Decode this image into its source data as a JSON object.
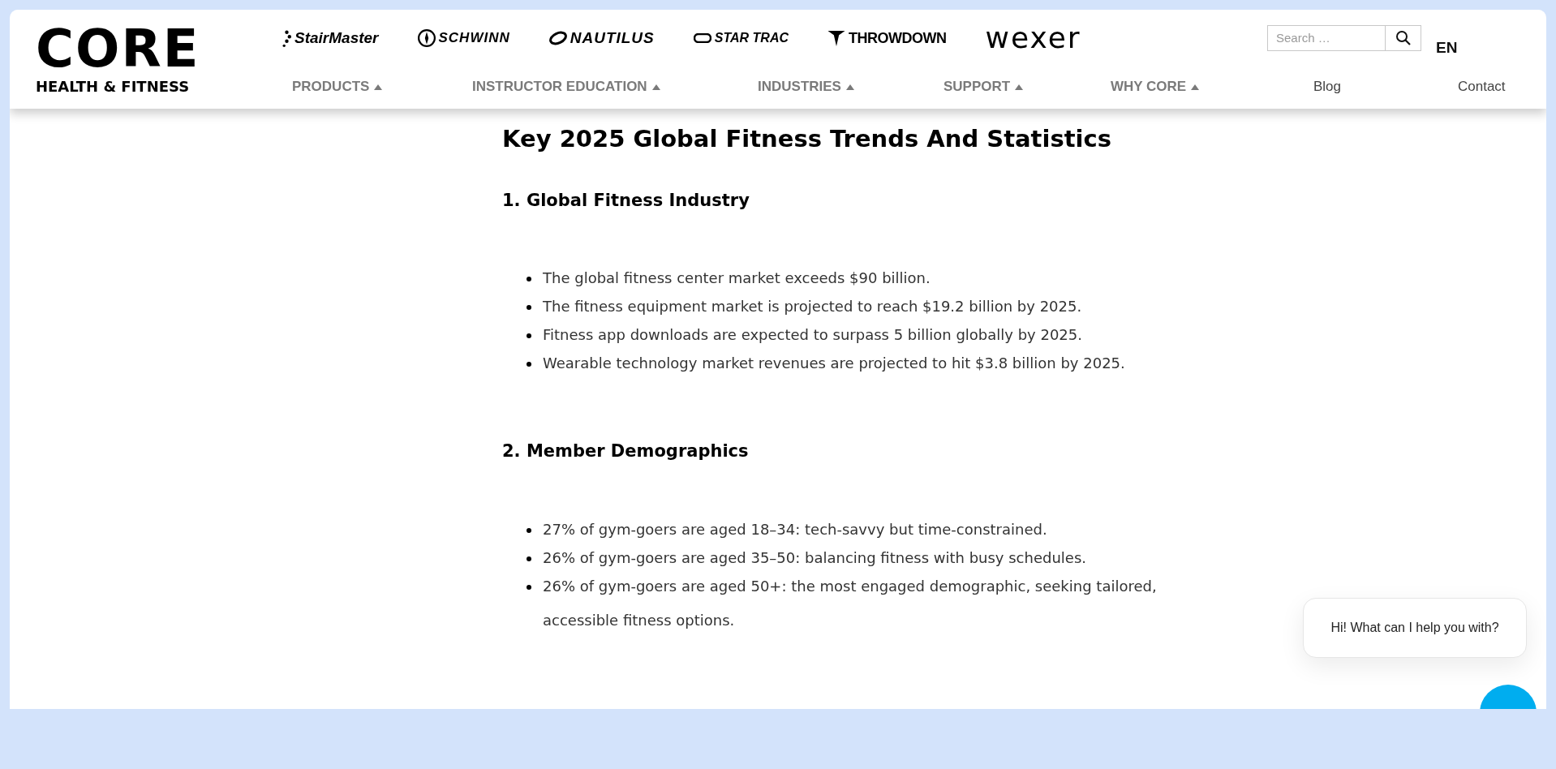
{
  "header": {
    "logo": {
      "word": "CORE",
      "tagline": "HEALTH & FITNESS"
    },
    "brands": [
      "StairMaster",
      "SCHWINN",
      "NAUTILUS",
      "STAR TRAC",
      "THROWDOWN",
      "wexer"
    ],
    "search": {
      "placeholder": "Search …"
    },
    "language": "EN",
    "nav": [
      {
        "label": "PRODUCTS",
        "kind": "dropdown"
      },
      {
        "label": "INSTRUCTOR EDUCATION",
        "kind": "dropdown"
      },
      {
        "label": "INDUSTRIES",
        "kind": "dropdown"
      },
      {
        "label": "SUPPORT",
        "kind": "dropdown"
      },
      {
        "label": "WHY CORE",
        "kind": "dropdown"
      },
      {
        "label": "Blog",
        "kind": "link"
      },
      {
        "label": "Contact",
        "kind": "link"
      }
    ]
  },
  "article": {
    "title": "Key 2025 Global Fitness Trends And Statistics",
    "sections": [
      {
        "heading": "1. Global Fitness Industry",
        "bullets": [
          "The global fitness center market exceeds $90 billion.",
          "The fitness equipment market is projected to reach $19.2 billion by 2025.",
          "Fitness app downloads are expected to surpass 5 billion globally by 2025.",
          "Wearable technology market revenues are projected to hit $3.8 billion by 2025."
        ]
      },
      {
        "heading": "2. Member Demographics",
        "bullets": [
          "27% of gym-goers are aged 18–34: tech-savvy but time-constrained.",
          "26% of gym-goers are aged 35–50: balancing fitness with busy schedules.",
          "26% of gym-goers are aged 50+: the most engaged demographic, seeking tailored, accessible fitness options."
        ]
      }
    ]
  },
  "chat": {
    "greeting": "Hi! What can I help you with?"
  }
}
